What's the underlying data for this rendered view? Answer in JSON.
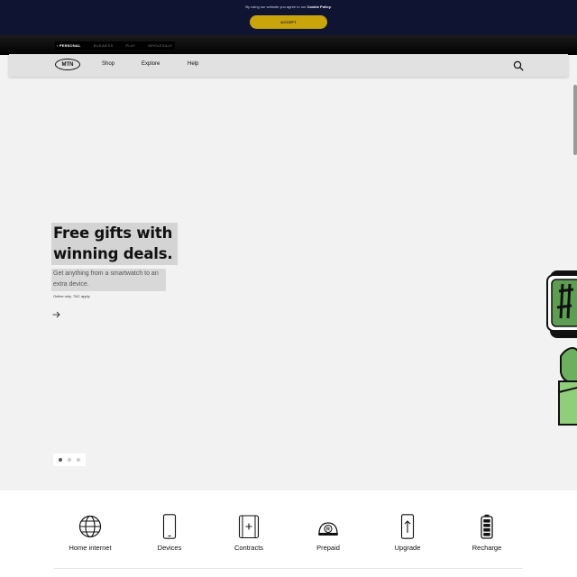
{
  "cookie": {
    "text": "By using our website you agree to our",
    "link": "Cookie Policy.",
    "accept": "ACCEPT"
  },
  "segments": [
    "PERSONAL",
    "BUSINESS",
    "PLAY",
    "WHOLESALE"
  ],
  "nav": {
    "logo": "MTN",
    "links": [
      "Shop",
      "Explore",
      "Help"
    ]
  },
  "hero": {
    "title": "Free gifts with winning deals.",
    "subtitle": "Get anything from a smartwatch to an extra device.",
    "note": "Online only. T&C apply.",
    "slides": 3,
    "active_slide": 1
  },
  "quick_links": [
    {
      "label": "Home internet",
      "icon": "globe-icon"
    },
    {
      "label": "Devices",
      "icon": "phone-icon"
    },
    {
      "label": "Contracts",
      "icon": "contract-phone-icon"
    },
    {
      "label": "Prepaid",
      "icon": "prepaid-icon"
    },
    {
      "label": "Upgrade",
      "icon": "upgrade-phone-icon"
    },
    {
      "label": "Recharge",
      "icon": "recharge-battery-icon"
    }
  ],
  "colors": {
    "cookie_bg": "#0f1433",
    "accept": "#c9a40a",
    "nav_bg": "#e1e1e1",
    "hero_bg": "#f2f2f2",
    "deco_green": "#5d9e52"
  }
}
